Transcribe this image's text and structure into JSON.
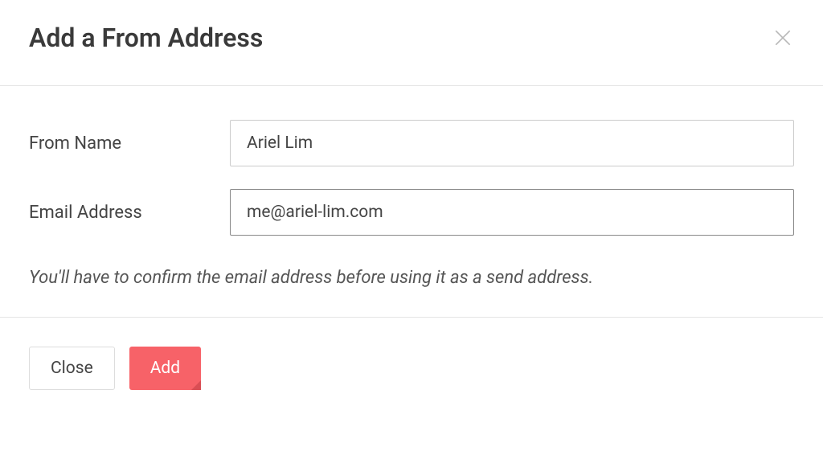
{
  "modal": {
    "title": "Add a From Address",
    "form": {
      "from_name": {
        "label": "From Name",
        "value": "Ariel Lim"
      },
      "email_address": {
        "label": "Email Address",
        "value": "me@ariel-lim.com"
      }
    },
    "helper": "You'll have to confirm the email address before using it as a send address.",
    "footer": {
      "close_label": "Close",
      "add_label": "Add"
    }
  }
}
